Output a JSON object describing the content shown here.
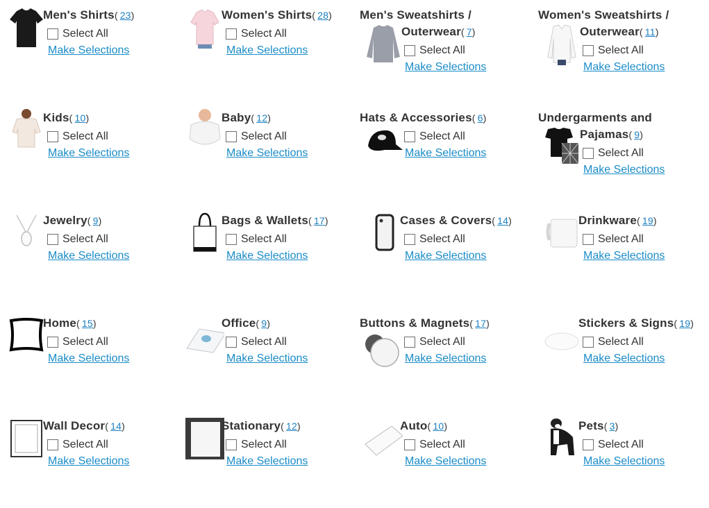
{
  "select_all_label": "Select All",
  "make_selections_label": "Make Selections",
  "categories": [
    {
      "name": "Men's Shirts",
      "count": "23",
      "icon": "tshirt-black-icon"
    },
    {
      "name": "Women's Shirts",
      "count": "28",
      "icon": "tshirt-pink-icon"
    },
    {
      "name1": "Men's Sweatshirts /",
      "name2": "Outerwear",
      "count": "7",
      "icon": "sweatshirt-icon"
    },
    {
      "name1": "Women's Sweatshirts /",
      "name2": "Outerwear",
      "count": "11",
      "icon": "jacket-white-icon"
    },
    {
      "name": "Kids",
      "count": "10",
      "icon": "kids-shirt-icon"
    },
    {
      "name": "Baby",
      "count": "12",
      "icon": "baby-onesie-icon"
    },
    {
      "name": "Hats & Accessories",
      "count": "6",
      "icon": "cap-icon"
    },
    {
      "name1": "Undergarments and",
      "name2": "Pajamas",
      "count": "9",
      "icon": "pajamas-icon"
    },
    {
      "name": "Jewelry",
      "count": "9",
      "icon": "necklace-icon"
    },
    {
      "name": "Bags & Wallets",
      "count": "17",
      "icon": "tote-bag-icon"
    },
    {
      "name": "Cases & Covers",
      "count": "14",
      "icon": "phone-case-icon"
    },
    {
      "name": "Drinkware",
      "count": "19",
      "icon": "mug-icon"
    },
    {
      "name": "Home",
      "count": "15",
      "icon": "pillow-icon"
    },
    {
      "name": "Office",
      "count": "9",
      "icon": "mousepad-icon"
    },
    {
      "name": "Buttons & Magnets",
      "count": "17",
      "icon": "button-pin-icon"
    },
    {
      "name": "Stickers & Signs",
      "count": "19",
      "icon": "sticker-icon"
    },
    {
      "name": "Wall Decor",
      "count": "14",
      "icon": "frame-icon"
    },
    {
      "name": "Stationary",
      "count": "12",
      "icon": "notebook-icon"
    },
    {
      "name": "Auto",
      "count": "10",
      "icon": "bumper-sticker-icon"
    },
    {
      "name": "Pets",
      "count": "3",
      "icon": "dog-icon"
    }
  ]
}
